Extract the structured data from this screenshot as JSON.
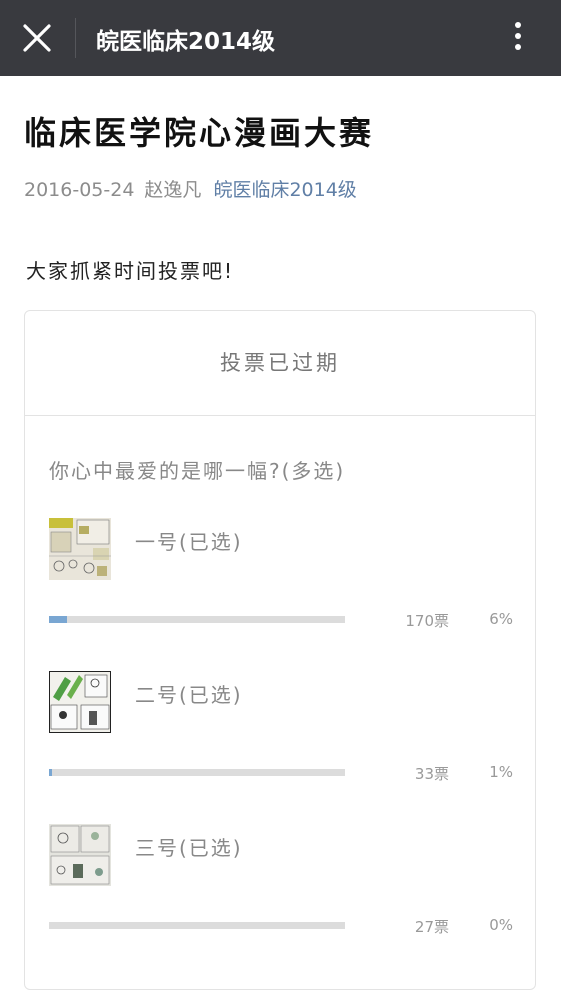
{
  "topbar": {
    "title": "皖医临床2014级",
    "close_icon": "close-icon",
    "more_icon": "more-vertical-icon",
    "background": "#393a3f"
  },
  "article": {
    "title": "临床医学院心漫画大赛",
    "date": "2016-05-24",
    "author": "赵逸凡",
    "account": "皖医临床2014级",
    "account_color": "#607fa6",
    "intro": "大家抓紧时间投票吧!"
  },
  "vote": {
    "status": "投票已过期",
    "question": "你心中最爱的是哪一幅?(多选)",
    "bar_color": "#79a6d2",
    "options": [
      {
        "label": "一号(已选)",
        "votes": "170票",
        "percent_label": "6%",
        "fill": 0.06
      },
      {
        "label": "二号(已选)",
        "votes": "33票",
        "percent_label": "1%",
        "fill": 0.01
      },
      {
        "label": "三号(已选)",
        "votes": "27票",
        "percent_label": "0%",
        "fill": 0.0
      }
    ]
  }
}
